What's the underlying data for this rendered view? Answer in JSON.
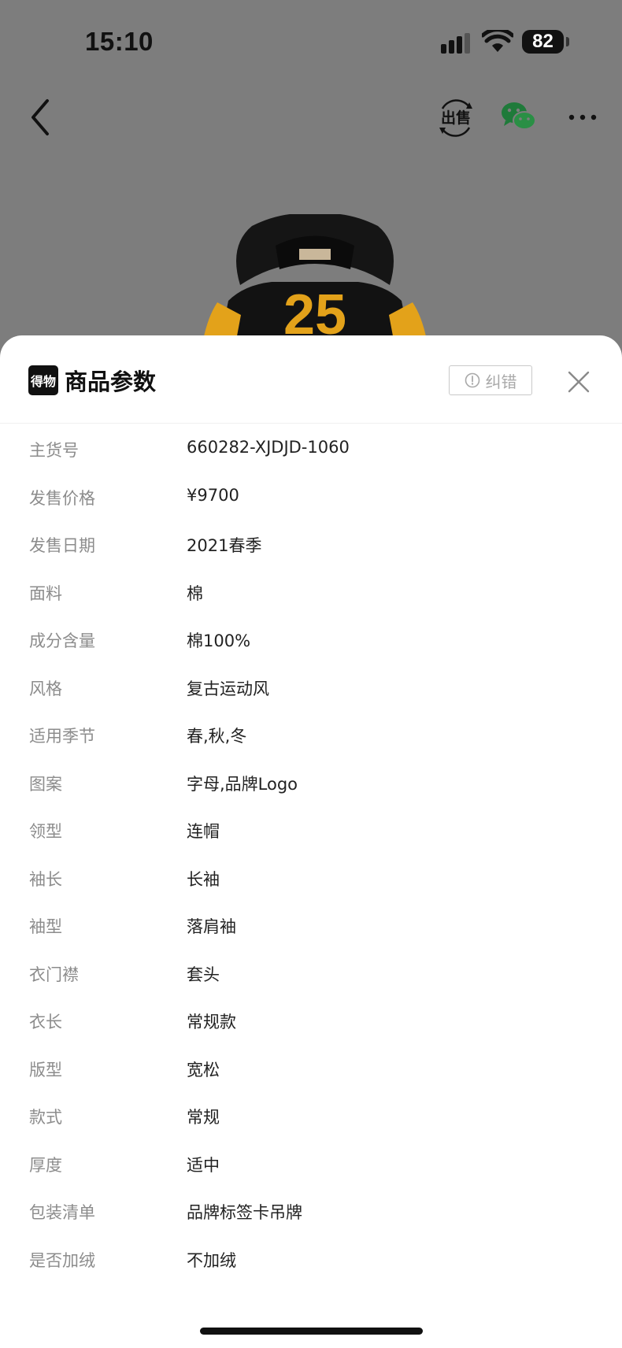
{
  "status_bar": {
    "time": "15:10",
    "battery": "82"
  },
  "nav": {
    "sell_label": "出售"
  },
  "product": {
    "number": "25"
  },
  "sheet": {
    "brand_logo_text": "得物",
    "title": "商品参数",
    "report_label": "纠错",
    "params": [
      {
        "label": "主货号",
        "value": "660282-XJDJD-1060"
      },
      {
        "label": "发售价格",
        "value": "¥9700"
      },
      {
        "label": "发售日期",
        "value": "2021春季"
      },
      {
        "label": "面料",
        "value": "棉"
      },
      {
        "label": "成分含量",
        "value": "棉100%"
      },
      {
        "label": "风格",
        "value": "复古运动风"
      },
      {
        "label": "适用季节",
        "value": "春,秋,冬"
      },
      {
        "label": "图案",
        "value": "字母,品牌Logo"
      },
      {
        "label": "领型",
        "value": "连帽"
      },
      {
        "label": "袖长",
        "value": "长袖"
      },
      {
        "label": "袖型",
        "value": "落肩袖"
      },
      {
        "label": "衣门襟",
        "value": "套头"
      },
      {
        "label": "衣长",
        "value": "常规款"
      },
      {
        "label": "版型",
        "value": "宽松"
      },
      {
        "label": "款式",
        "value": "常规"
      },
      {
        "label": "厚度",
        "value": "适中"
      },
      {
        "label": "包装清单",
        "value": "品牌标签卡吊牌"
      },
      {
        "label": "是否加绒",
        "value": "不加绒"
      }
    ]
  }
}
